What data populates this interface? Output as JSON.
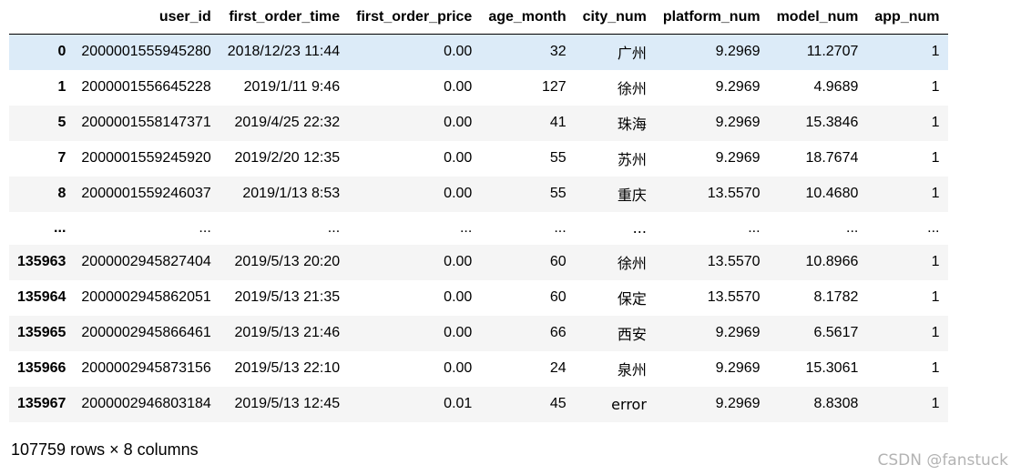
{
  "table": {
    "columns": [
      "",
      "user_id",
      "first_order_time",
      "first_order_price",
      "age_month",
      "city_num",
      "platform_num",
      "model_num",
      "app_num"
    ],
    "rows": [
      {
        "index": "0",
        "user_id": "2000001555945280",
        "first_order_time": "2018/12/23 11:44",
        "first_order_price": "0.00",
        "age_month": "32",
        "city_num": "广州",
        "platform_num": "9.2969",
        "model_num": "11.2707",
        "app_num": "1",
        "highlighted": true
      },
      {
        "index": "1",
        "user_id": "2000001556645228",
        "first_order_time": "2019/1/11 9:46",
        "first_order_price": "0.00",
        "age_month": "127",
        "city_num": "徐州",
        "platform_num": "9.2969",
        "model_num": "4.9689",
        "app_num": "1"
      },
      {
        "index": "5",
        "user_id": "2000001558147371",
        "first_order_time": "2019/4/25 22:32",
        "first_order_price": "0.00",
        "age_month": "41",
        "city_num": "珠海",
        "platform_num": "9.2969",
        "model_num": "15.3846",
        "app_num": "1"
      },
      {
        "index": "7",
        "user_id": "2000001559245920",
        "first_order_time": "2019/2/20 12:35",
        "first_order_price": "0.00",
        "age_month": "55",
        "city_num": "苏州",
        "platform_num": "9.2969",
        "model_num": "18.7674",
        "app_num": "1"
      },
      {
        "index": "8",
        "user_id": "2000001559246037",
        "first_order_time": "2019/1/13 8:53",
        "first_order_price": "0.00",
        "age_month": "55",
        "city_num": "重庆",
        "platform_num": "13.5570",
        "model_num": "10.4680",
        "app_num": "1"
      },
      {
        "index": "...",
        "user_id": "...",
        "first_order_time": "...",
        "first_order_price": "...",
        "age_month": "...",
        "city_num": "...",
        "platform_num": "...",
        "model_num": "...",
        "app_num": "...",
        "ellipsis": true
      },
      {
        "index": "135963",
        "user_id": "2000002945827404",
        "first_order_time": "2019/5/13 20:20",
        "first_order_price": "0.00",
        "age_month": "60",
        "city_num": "徐州",
        "platform_num": "13.5570",
        "model_num": "10.8966",
        "app_num": "1"
      },
      {
        "index": "135964",
        "user_id": "2000002945862051",
        "first_order_time": "2019/5/13 21:35",
        "first_order_price": "0.00",
        "age_month": "60",
        "city_num": "保定",
        "platform_num": "13.5570",
        "model_num": "8.1782",
        "app_num": "1"
      },
      {
        "index": "135965",
        "user_id": "2000002945866461",
        "first_order_time": "2019/5/13 21:46",
        "first_order_price": "0.00",
        "age_month": "66",
        "city_num": "西安",
        "platform_num": "9.2969",
        "model_num": "6.5617",
        "app_num": "1"
      },
      {
        "index": "135966",
        "user_id": "2000002945873156",
        "first_order_time": "2019/5/13 22:10",
        "first_order_price": "0.00",
        "age_month": "24",
        "city_num": "泉州",
        "platform_num": "9.2969",
        "model_num": "15.3061",
        "app_num": "1"
      },
      {
        "index": "135967",
        "user_id": "2000002946803184",
        "first_order_time": "2019/5/13 12:45",
        "first_order_price": "0.01",
        "age_month": "45",
        "city_num": "error",
        "platform_num": "9.2969",
        "model_num": "8.8308",
        "app_num": "1"
      }
    ],
    "highlight_color": "#dcebf8",
    "stripe_color": "#f5f5f5"
  },
  "shape_caption": "107759 rows × 8 columns",
  "watermark": "CSDN @fanstuck"
}
